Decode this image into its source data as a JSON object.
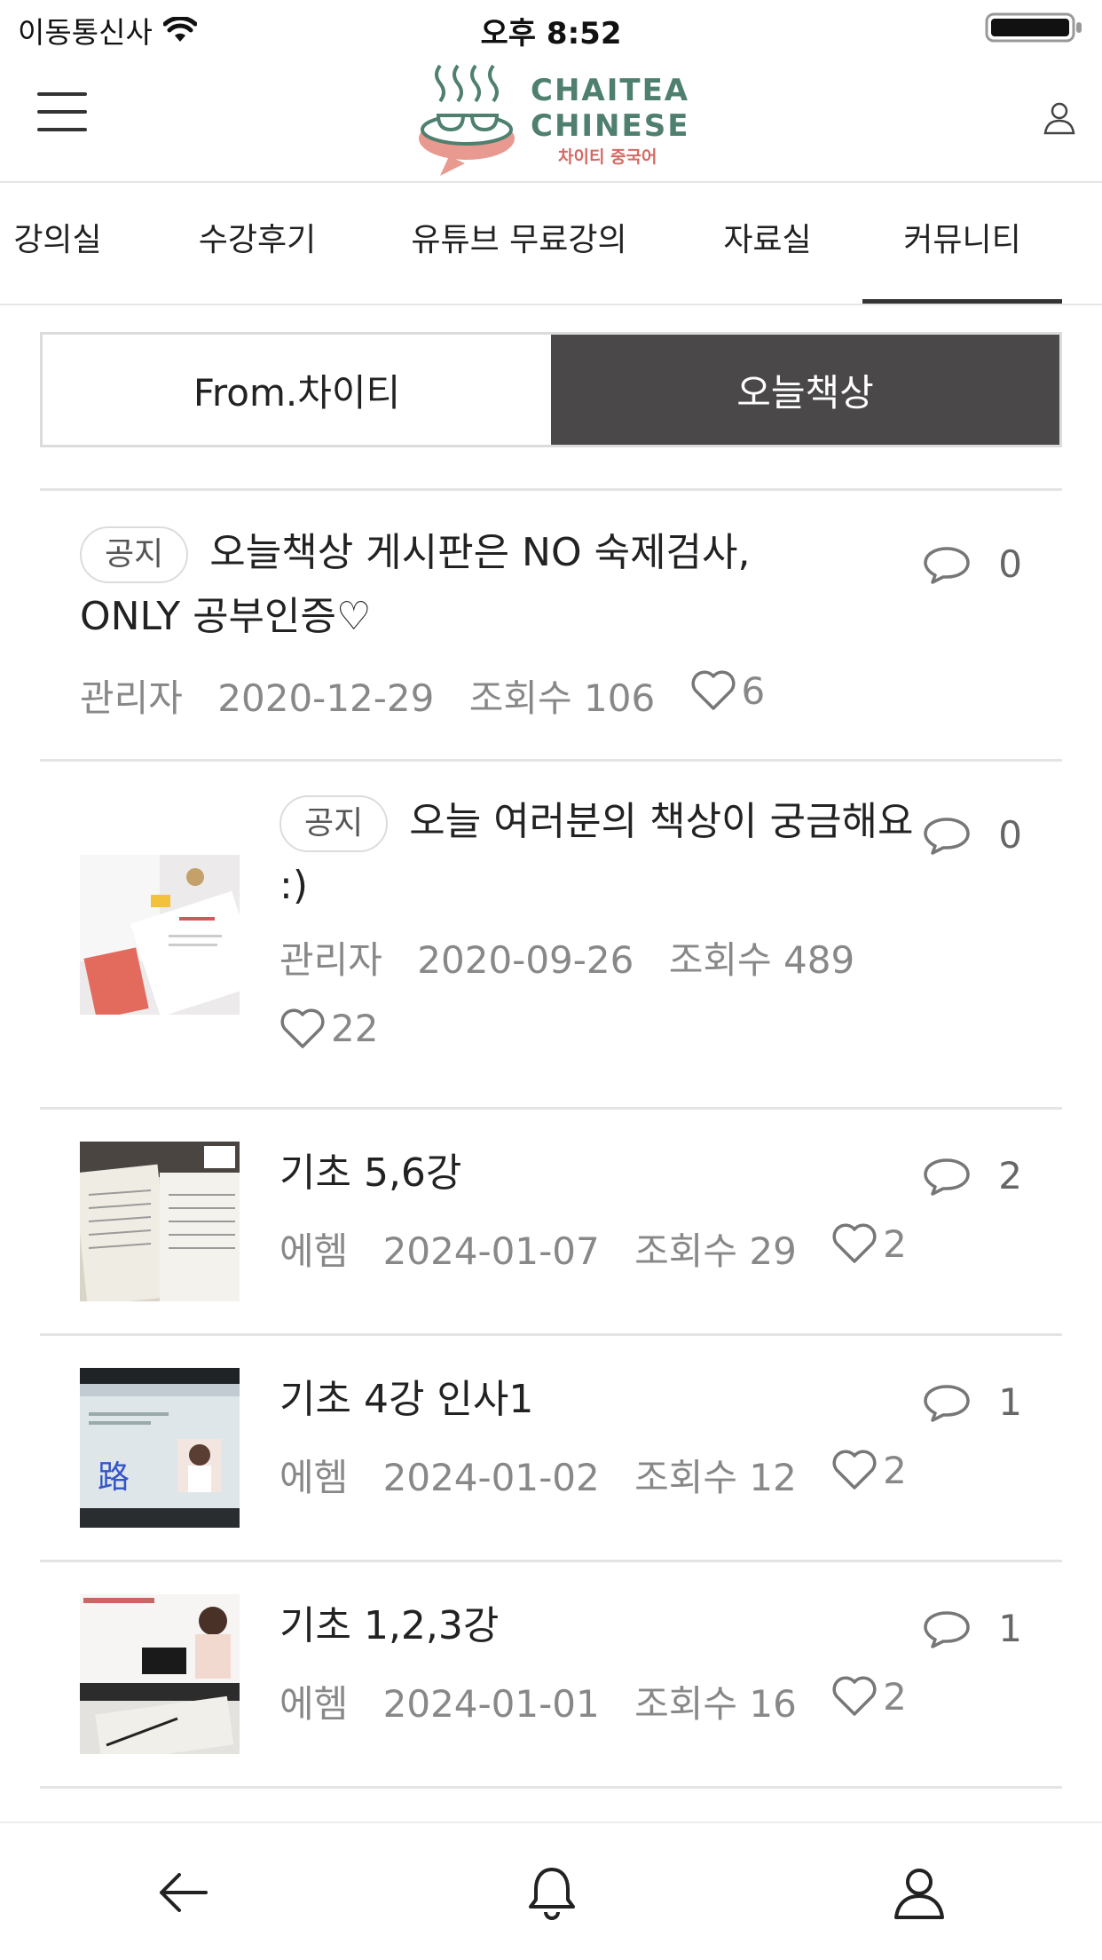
{
  "status_bar": {
    "carrier": "이동통신사",
    "time": "오후 8:52"
  },
  "header": {
    "logo_line1": "CHAITEA",
    "logo_line2": "CHINESE",
    "logo_sub": "차이티 중국어"
  },
  "tabs": [
    {
      "label": "강의실",
      "active": false
    },
    {
      "label": "수강후기",
      "active": false
    },
    {
      "label": "유튜브 무료강의",
      "active": false
    },
    {
      "label": "자료실",
      "active": false
    },
    {
      "label": "커뮤니티",
      "active": true
    }
  ],
  "segments": [
    {
      "label": "From.차이티",
      "active": false
    },
    {
      "label": "오늘책상",
      "active": true
    }
  ],
  "posts": [
    {
      "badge": "공지",
      "title": "오늘책상 게시판은 NO 숙제검사, ONLY 공부인증♡",
      "author": "관리자",
      "date": "2020-12-29",
      "views": "조회수 106",
      "likes": "6",
      "comments": "0"
    },
    {
      "badge": "공지",
      "title": "오늘 여러분의 책상이 궁금해요 :)",
      "author": "관리자",
      "date": "2020-09-26",
      "views": "조회수 489",
      "likes": "22",
      "comments": "0"
    },
    {
      "title": "기초 5,6강",
      "author": "에헴",
      "date": "2024-01-07",
      "views": "조회수 29",
      "likes": "2",
      "comments": "2"
    },
    {
      "title": "기초 4강 인사1",
      "author": "에헴",
      "date": "2024-01-02",
      "views": "조회수 12",
      "likes": "2",
      "comments": "1"
    },
    {
      "title": "기초 1,2,3강",
      "author": "에헴",
      "date": "2024-01-01",
      "views": "조회수 16",
      "likes": "2",
      "comments": "1"
    }
  ],
  "colors": {
    "accent_dark": "#4a4849",
    "logo_green": "#4f7f6e",
    "logo_pink": "#e89a90"
  }
}
